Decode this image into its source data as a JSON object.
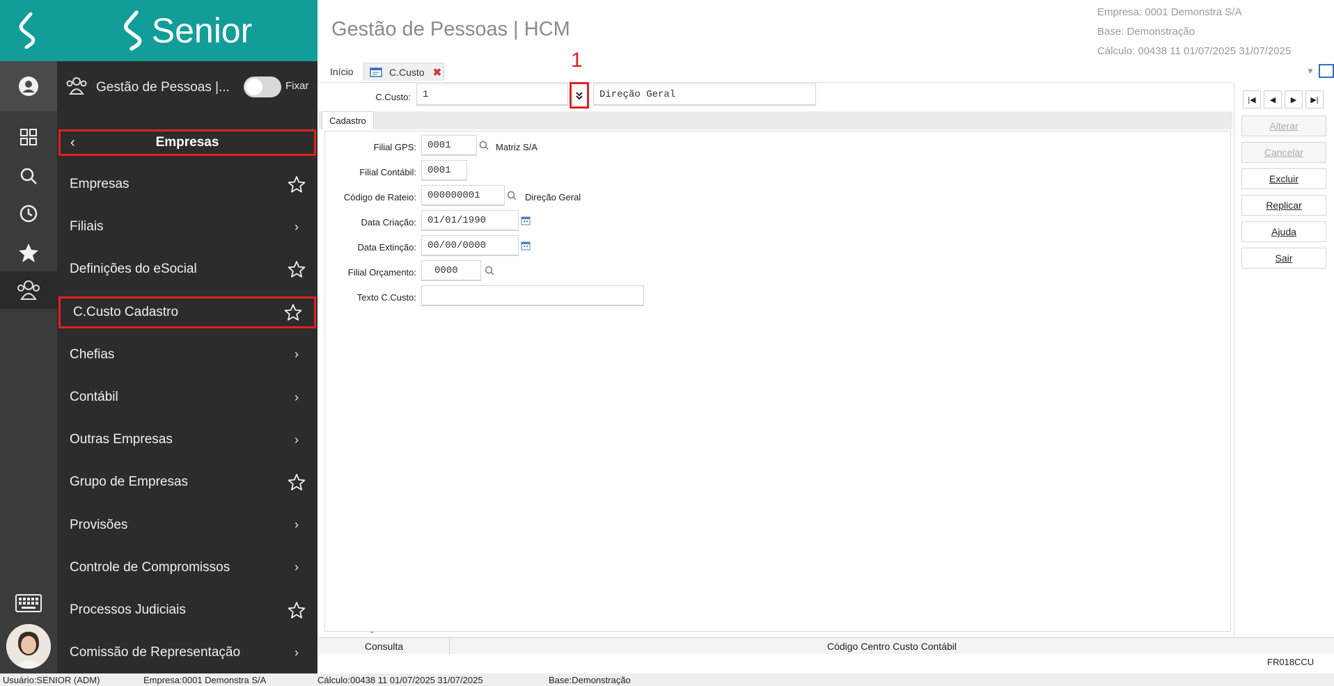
{
  "brand": {
    "name": "Senior"
  },
  "module": {
    "title": "Gestão de Pessoas |...",
    "pin_label": "Fixar"
  },
  "breadcrumb": {
    "title": "Empresas"
  },
  "menu": {
    "items": [
      {
        "label": "Empresas",
        "end": "star"
      },
      {
        "label": "Filiais",
        "end": "chevron"
      },
      {
        "label": "Definições do eSocial",
        "end": "star"
      },
      {
        "label": "C.Custo Cadastro",
        "end": "star"
      },
      {
        "label": "Chefias",
        "end": "chevron"
      },
      {
        "label": "Contábil",
        "end": "chevron"
      },
      {
        "label": "Outras Empresas",
        "end": "chevron"
      },
      {
        "label": "Grupo de Empresas",
        "end": "star"
      },
      {
        "label": "Provisões",
        "end": "chevron"
      },
      {
        "label": "Controle de Compromissos",
        "end": "chevron"
      },
      {
        "label": "Processos Judiciais",
        "end": "star"
      },
      {
        "label": "Comissão de Representação",
        "end": "chevron"
      }
    ]
  },
  "header": {
    "title": "Gestão de Pessoas | HCM",
    "empresa": "Empresa: 0001  Demonstra S/A",
    "base": "Base: Demonstração",
    "calculo": "Cálculo: 00438  11  01/07/2025  31/07/2025"
  },
  "tabs": {
    "inicio": "Início",
    "ccusto": "C.Custo"
  },
  "callout": {
    "number": "1"
  },
  "form": {
    "ccusto_label": "C.Custo:",
    "ccusto_value": "1",
    "ccusto_desc": "Direção Geral",
    "subtab": "Cadastro",
    "filial_gps_label": "Filial GPS:",
    "filial_gps_value": "0001",
    "filial_gps_desc": "Matriz S/A",
    "filial_contabil_label": "Filial Contábil:",
    "filial_contabil_value": "0001",
    "rateio_label": "Código de Rateio:",
    "rateio_value": "000000001",
    "rateio_desc": "Direção Geral",
    "data_criacao_label": "Data Criação:",
    "data_criacao_value": "01/01/1990",
    "data_extincao_label": "Data Extinção:",
    "data_extincao_value": "00/00/0000",
    "filial_orc_label": "Filial Orçamento:",
    "filial_orc_value": "0000",
    "texto_label": "Texto C.Custo:",
    "texto_value": ""
  },
  "actions": {
    "alterar": "Alterar",
    "cancelar": "Cancelar",
    "excluir": "Excluir",
    "replicar": "Replicar",
    "ajuda": "Ajuda",
    "sair": "Sair"
  },
  "status": {
    "mode": "Consulta",
    "hint": "Código Centro Custo Contábil",
    "program": "FR018CCU"
  },
  "footer": {
    "usuario": "Usuário:SENIOR (ADM)",
    "empresa": "Empresa:0001  Demonstra S/A",
    "calculo": "Cálculo:00438  11  01/07/2025  31/07/2025",
    "base": "Base:Demonstração"
  },
  "colors": {
    "brand_teal": "#139d98",
    "highlight_red": "#e02020",
    "menu_bg": "#2c2c2c",
    "rail_bg": "#3b3b3b"
  }
}
